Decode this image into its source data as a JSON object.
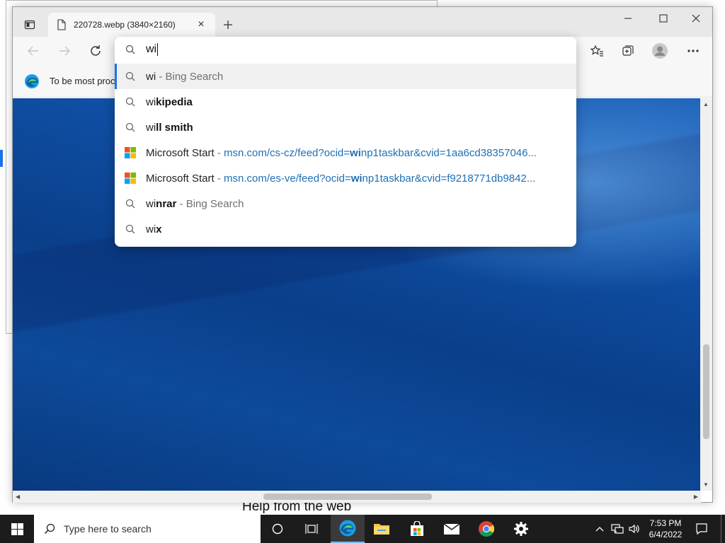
{
  "background_window": {
    "caption": "Help from the web"
  },
  "browser": {
    "tab": {
      "title": "220728.webp (3840×2160)"
    },
    "favorites_bar": {
      "logo_text": "e",
      "text": "To be most proc"
    },
    "omnibox": {
      "typed": "wi",
      "suggestions": [
        {
          "kind": "search",
          "prefix": "wi",
          "bold": "",
          "suffix": " - Bing Search"
        },
        {
          "kind": "search",
          "prefix": "wi",
          "bold": "kipedia",
          "suffix": ""
        },
        {
          "kind": "search",
          "prefix": "wi",
          "bold": "ll smith",
          "suffix": ""
        },
        {
          "kind": "site",
          "title": "Microsoft Start",
          "sep": " - ",
          "url_a": "msn.com/cs-cz/feed?ocid=",
          "url_bold": "wi",
          "url_b": "np1taskbar&cvid=1aa6cd38357046..."
        },
        {
          "kind": "site",
          "title": "Microsoft Start",
          "sep": " - ",
          "url_a": "msn.com/es-ve/feed?ocid=",
          "url_bold": "wi",
          "url_b": "np1taskbar&cvid=f9218771db9842..."
        },
        {
          "kind": "search",
          "prefix": "wi",
          "bold": "nrar",
          "suffix": " - Bing Search"
        },
        {
          "kind": "search",
          "prefix": "wi",
          "bold": "x",
          "suffix": ""
        }
      ]
    }
  },
  "taskbar": {
    "search_placeholder": "Type here to search",
    "time": "7:53 PM",
    "date": "6/4/2022"
  }
}
